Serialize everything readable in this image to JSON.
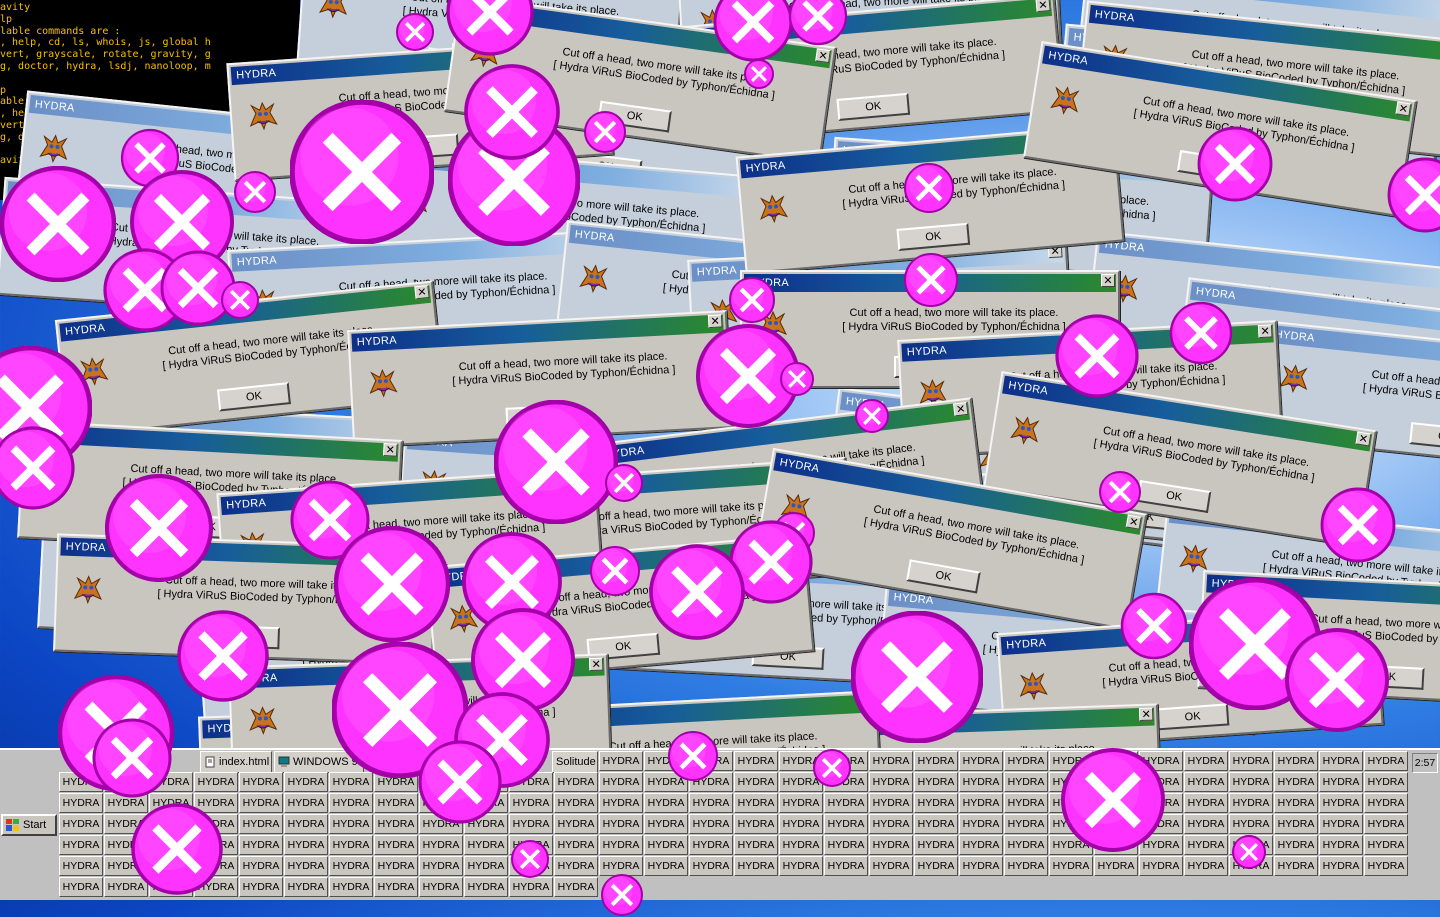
{
  "terminal": {
    "lines": [
      "avity",
      "lp",
      "lable commands are :",
      ", help, cd, ls, whois, js, global h",
      "vert, grayscale, rotate, gravity, g",
      "g, doctor, hydra, lsdj, nanoloop, m",
      "",
      "p",
      "able commands are :",
      ", help, cd, ls, whois,",
      "vert, grayscale, rotat",
      "g, doctor, hydra, lsd",
      "",
      "avity"
    ]
  },
  "dialog": {
    "title": "HYDRA",
    "message_line1": "Cut off a head, two more will take its place.",
    "message_line2": "[ Hydra ViRuS BioCoded by Typhon/Échidna ]",
    "ok_label": "OK",
    "close_label": "✕",
    "icon": "hydra-dragon-icon"
  },
  "taskbar": {
    "start_label": "Start",
    "open_tasks": [
      {
        "label": "index.html",
        "icon": "document-icon"
      },
      {
        "label": "WINDOWS 98",
        "icon": "computer-icon"
      },
      {
        "label": "Solitude",
        "icon": ""
      }
    ],
    "task_button_label": "HYDRA",
    "clock": "2:57"
  },
  "colors": {
    "bubble": "#ff33ff",
    "bubble_dark": "#a400a8",
    "terminal_text": "#f6c000",
    "titlebar_start": "#0d2f8a",
    "titlebar_end": "#2b8a2a"
  },
  "close_bubble_icon": "pink-close-x-icon"
}
